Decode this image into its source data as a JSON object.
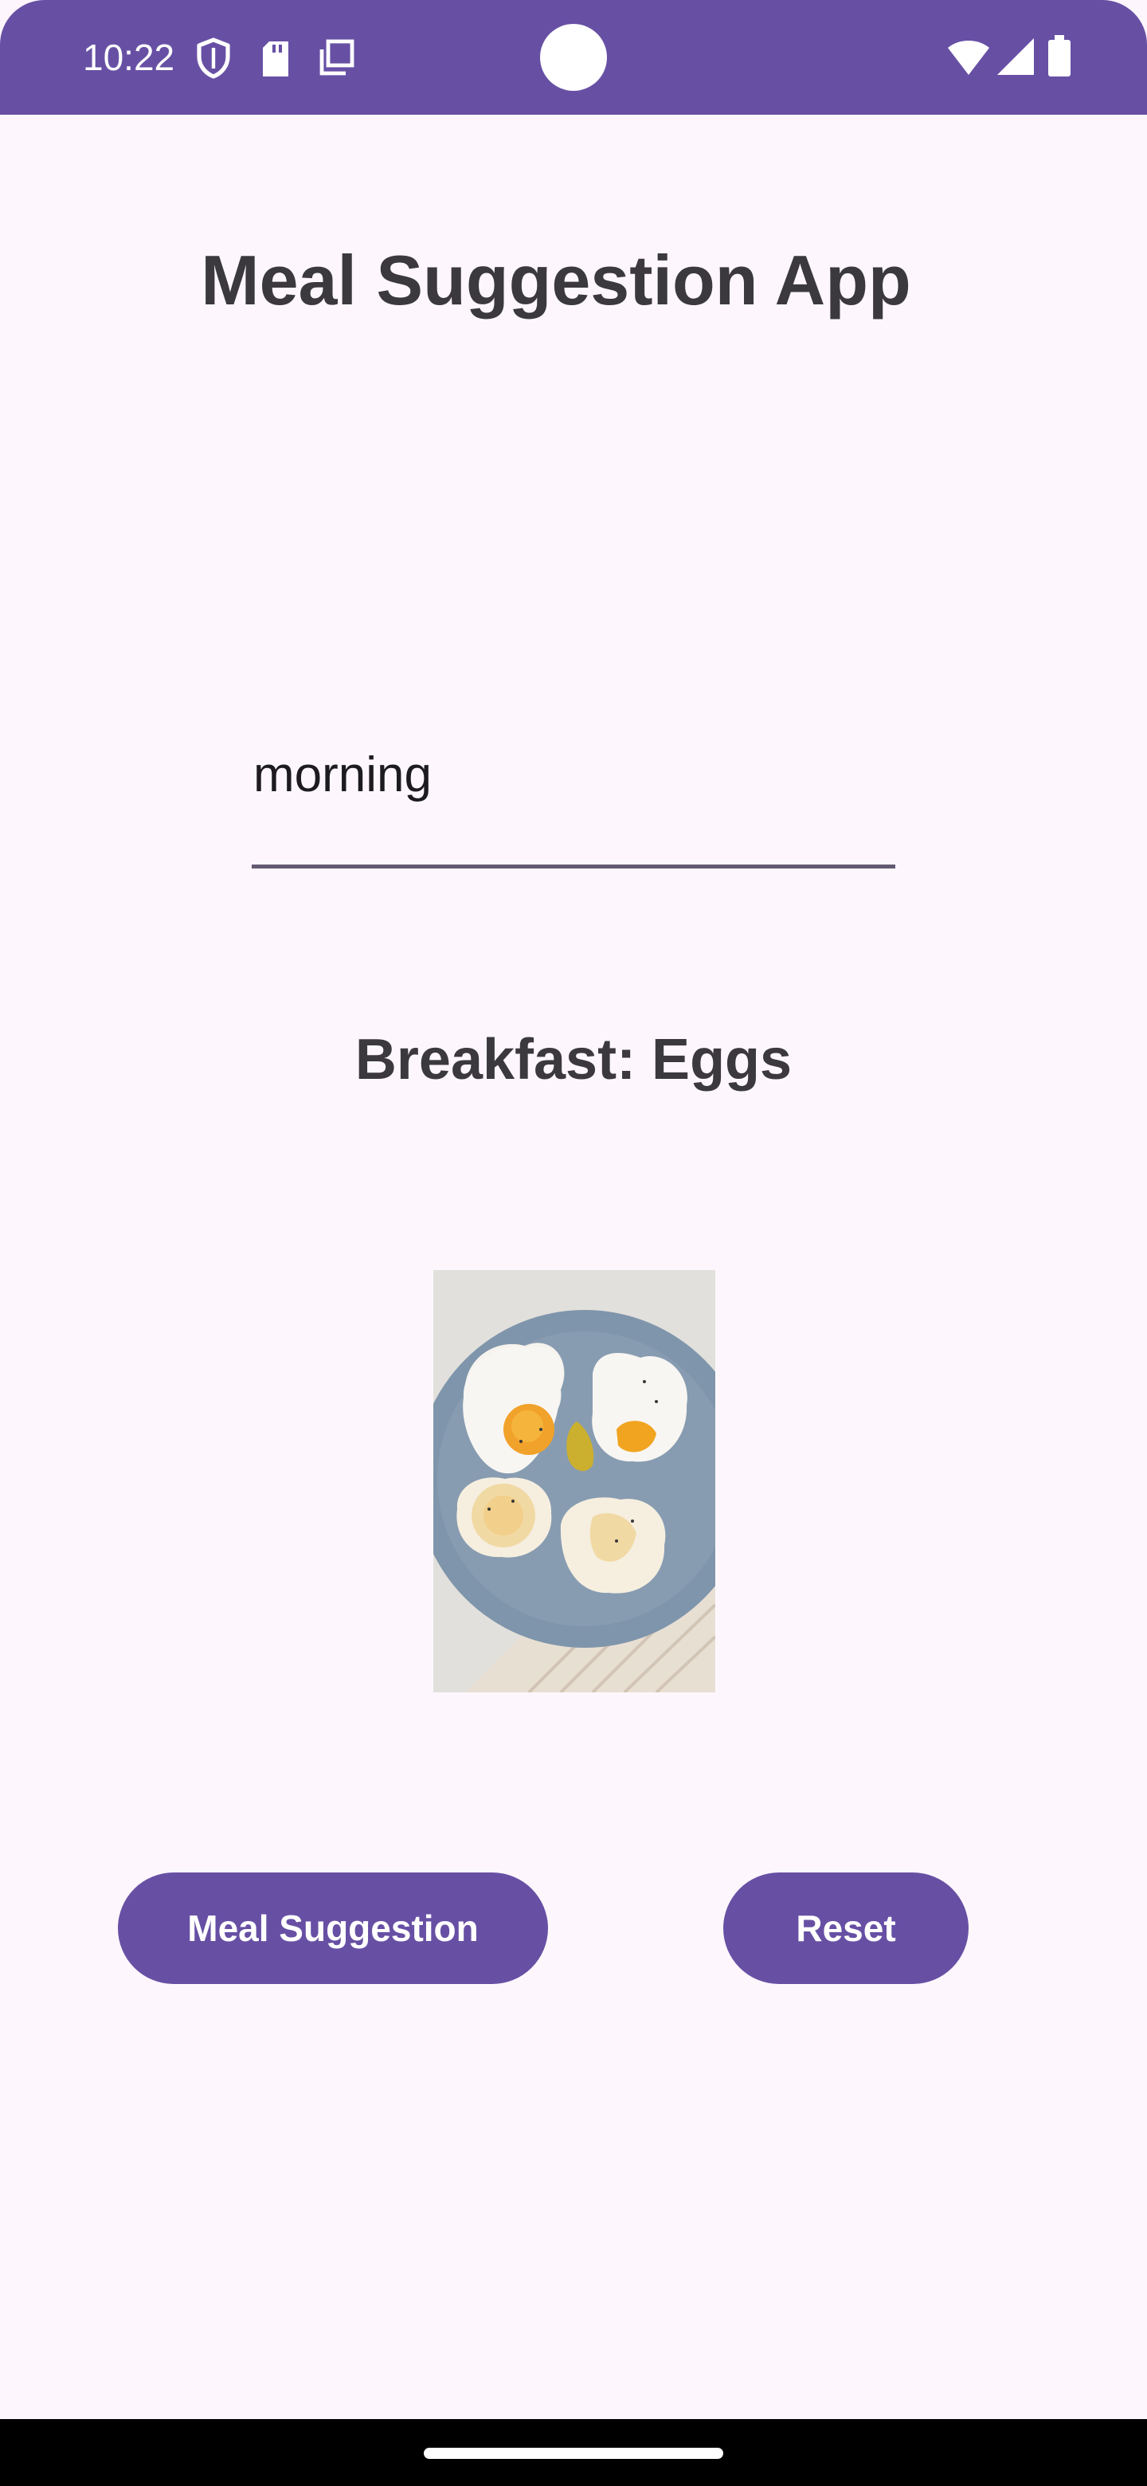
{
  "status_bar": {
    "time": "10:22",
    "background_color": "#6750a4",
    "left_icons": [
      "shield-icon",
      "sd-card-icon",
      "overlay-windows-icon"
    ],
    "right_icons": [
      "wifi-icon",
      "cell-signal-icon",
      "battery-icon"
    ]
  },
  "app": {
    "title": "Meal Suggestion App"
  },
  "input": {
    "value": "morning"
  },
  "result": {
    "suggestion": "Breakfast: Eggs",
    "image_subject": "fried-eggs-on-plate"
  },
  "buttons": {
    "meal_suggestion": "Meal Suggestion",
    "reset": "Reset",
    "color": "#6750a4"
  },
  "colors": {
    "background": "#fdf7fd",
    "text": "#3b383e",
    "accent": "#6750a4"
  }
}
